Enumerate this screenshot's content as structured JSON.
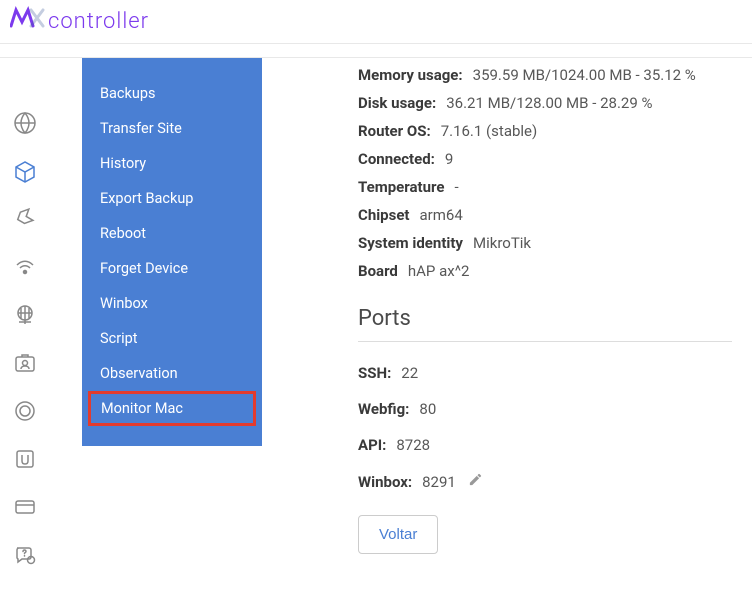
{
  "brand": {
    "name": "controller"
  },
  "sidebar": {
    "items": [
      {
        "label": "Backups"
      },
      {
        "label": "Transfer Site"
      },
      {
        "label": "History"
      },
      {
        "label": "Export Backup"
      },
      {
        "label": "Reboot"
      },
      {
        "label": "Forget Device"
      },
      {
        "label": "Winbox"
      },
      {
        "label": "Script"
      },
      {
        "label": "Observation"
      },
      {
        "label": "Monitor Mac"
      }
    ]
  },
  "device": {
    "memory_usage_label": "Memory usage:",
    "memory_usage_value": "359.59 MB/1024.00 MB - 35.12 %",
    "disk_usage_label": "Disk usage:",
    "disk_usage_value": "36.21 MB/128.00 MB - 28.29 %",
    "router_os_label": "Router OS:",
    "router_os_value": "7.16.1 (stable)",
    "connected_label": "Connected:",
    "connected_value": "9",
    "temperature_label": "Temperature",
    "temperature_value": "-",
    "chipset_label": "Chipset",
    "chipset_value": "arm64",
    "system_identity_label": "System identity",
    "system_identity_value": "MikroTik",
    "board_label": "Board",
    "board_value": "hAP ax^2"
  },
  "ports": {
    "title": "Ports",
    "ssh_label": "SSH:",
    "ssh_value": "22",
    "webfig_label": "Webfig:",
    "webfig_value": "80",
    "api_label": "API:",
    "api_value": "8728",
    "winbox_label": "Winbox:",
    "winbox_value": "8291"
  },
  "actions": {
    "back_label": "Voltar"
  }
}
